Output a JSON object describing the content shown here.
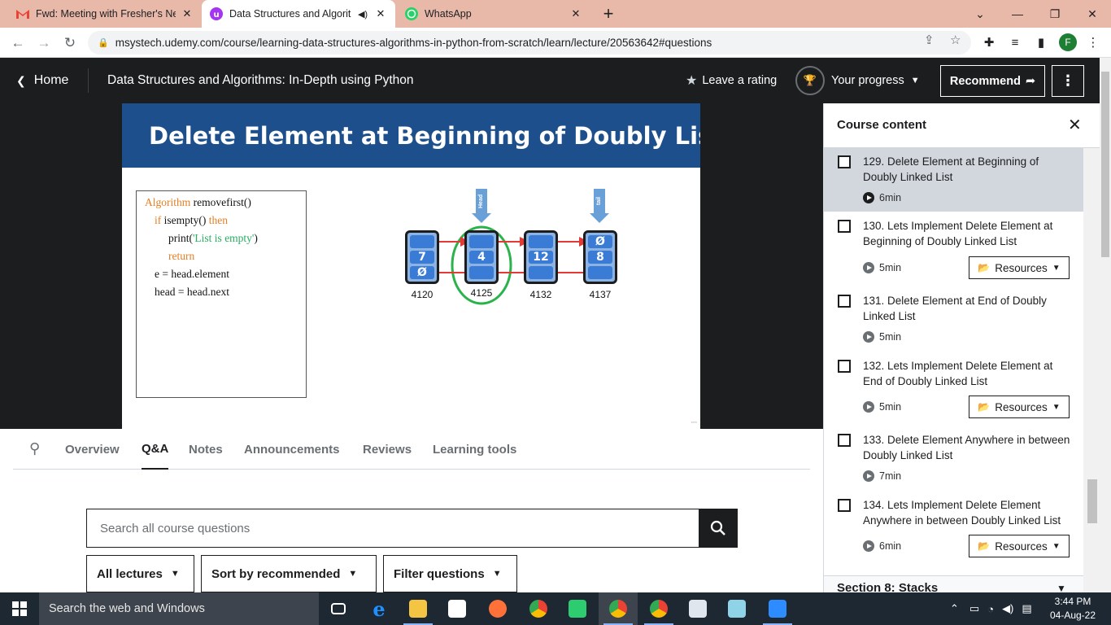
{
  "browser": {
    "tabs": [
      {
        "title": "Fwd: Meeting with Fresher's New",
        "icon": "gmail-icon",
        "active": false
      },
      {
        "title": "Data Structures and Algorith",
        "icon": "udemy-icon",
        "active": true
      },
      {
        "title": "WhatsApp",
        "icon": "whatsapp-icon",
        "active": false
      }
    ],
    "new_tab": "+",
    "url": "msystech.udemy.com/course/learning-data-structures-algorithms-in-python-from-scratch/learn/lecture/20563642#questions",
    "profile_initial": "F"
  },
  "header": {
    "home_label": "Home",
    "course_title": "Data Structures and Algorithms: In-Depth using Python",
    "rating_label": "Leave a rating",
    "progress_label": "Your progress",
    "recommend_label": "Recommend"
  },
  "slide": {
    "title": "Delete Element at Beginning of Doubly List",
    "algorithm": [
      {
        "kw": "Algorithm",
        "rest": " removefirst()"
      },
      {
        "kw": "if",
        "rest": " isempty() ",
        "kw2": "then"
      },
      {
        "rest": "print(",
        "str": "'List is empty'",
        "rest2": ")"
      },
      {
        "kw": "return"
      },
      {
        "rest": "e = head.element"
      },
      {
        "rest": "head = head.next"
      }
    ],
    "nodes": [
      {
        "prev": "",
        "value": "7",
        "next": "Ø",
        "address": "4120"
      },
      {
        "prev": "",
        "value": "4",
        "next": "",
        "address": "4125"
      },
      {
        "prev": "",
        "value": "12",
        "next": "",
        "address": "4132"
      },
      {
        "prev": "Ø",
        "value": "8",
        "next": "",
        "address": "4137"
      }
    ],
    "head_label": "Head",
    "tail_label": "tail"
  },
  "lecture_tabs": [
    "Overview",
    "Q&A",
    "Notes",
    "Announcements",
    "Reviews",
    "Learning tools"
  ],
  "active_tab": "Q&A",
  "qa": {
    "search_placeholder": "Search all course questions",
    "filters": [
      "All lectures",
      "Sort by recommended",
      "Filter questions"
    ]
  },
  "sidebar": {
    "title": "Course content",
    "lectures": [
      {
        "name": "129. Delete Element at Beginning of Doubly Linked List",
        "duration": "6min",
        "resources": false,
        "current": true
      },
      {
        "name": "130. Lets Implement Delete Element at Beginning of Doubly Linked List",
        "duration": "5min",
        "resources": true,
        "current": false
      },
      {
        "name": "131. Delete Element at End of Doubly Linked List",
        "duration": "5min",
        "resources": false,
        "current": false
      },
      {
        "name": "132. Lets Implement Delete Element at End of Doubly Linked List",
        "duration": "5min",
        "resources": true,
        "current": false
      },
      {
        "name": "133. Delete Element Anywhere in between Doubly Linked List",
        "duration": "7min",
        "resources": false,
        "current": false
      },
      {
        "name": "134. Lets Implement Delete Element Anywhere in between Doubly Linked List",
        "duration": "6min",
        "resources": true,
        "current": false
      }
    ],
    "resources_label": "Resources",
    "next_section": "Section 8: Stacks"
  },
  "taskbar": {
    "search_text": "Search the web and Windows",
    "time": "3:44 PM",
    "date": "04-Aug-22"
  },
  "colors": {
    "udemy_dark": "#1c1d1f",
    "tab_strip": "#e8b8a8",
    "slide_banner": "#1d4f8c",
    "current_lecture_bg": "#d1d7dc"
  }
}
